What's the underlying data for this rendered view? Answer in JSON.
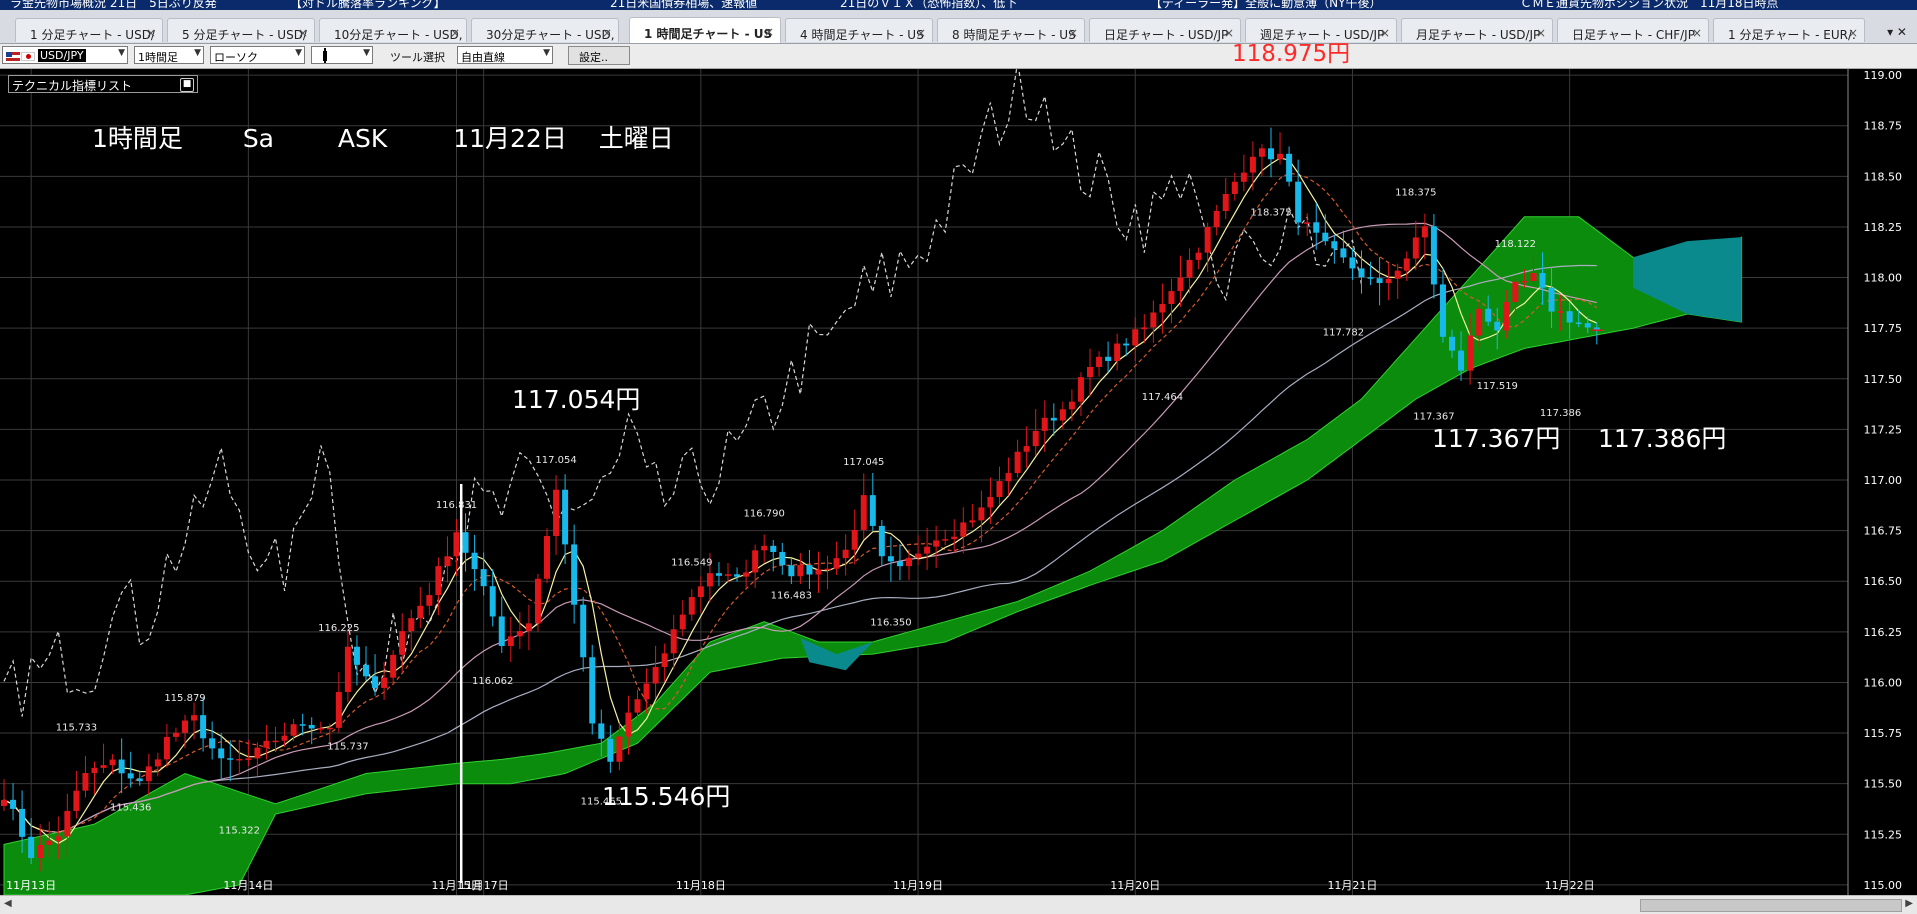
{
  "news_items": [
    "ラ金先物市場概況 21日　5日ぶり反発",
    "【対ドル騰落率ランキング】",
    "21日米国債券相場、速報値",
    "21日のＶＩＸ（恐怖指数）、低下",
    "【ディーラー発】全般に動意薄（NY午後）",
    "ＣＭＥ通貨先物ポジション状況　11月18日時点"
  ],
  "tabs": [
    {
      "label": "1 分足チャート - USD/"
    },
    {
      "label": "5 分足チャート - USD/"
    },
    {
      "label": "10分足チャート - USD,"
    },
    {
      "label": "30分足チャート - USD,"
    },
    {
      "label": "1 時間足チャート - US"
    },
    {
      "label": "4 時間足チャート - US"
    },
    {
      "label": "8 時間足チャート - US"
    },
    {
      "label": "日足チャート - USD/JP"
    },
    {
      "label": "週足チャート - USD/JP"
    },
    {
      "label": "月足チャート - USD/JP"
    },
    {
      "label": "日足チャート - CHF/JP"
    },
    {
      "label": "1 分足チャート - EUR/."
    }
  ],
  "active_tab": 4,
  "tab_close": "×",
  "tab_nav": "▾  ✕",
  "toolbar": {
    "symbol": "USD/JPY",
    "timeframe": "1時間足",
    "chart_type": "ローソク",
    "candle_icon": "candle-icon",
    "tool_label": "ツール選択",
    "tool_value": "自由直線",
    "settings_button": "設定.."
  },
  "tech_list": {
    "label": "テクニカル指標リスト"
  },
  "headline": {
    "timeframe": "1時間足",
    "sa": "Sa",
    "side": "ASK",
    "date": "11月22日",
    "weekday": "土曜日"
  },
  "annotations": {
    "high_red": "118.975円",
    "high_1": "117.054円",
    "low_1": "115.546円",
    "low_2": "117.367円",
    "low_3": "117.386円"
  },
  "colors": {
    "up": "#e0161b",
    "down": "#17b9ea",
    "ma_short": "#f7f3a0",
    "ma_mid": "#c89ab6",
    "ma_long": "#a8aec0",
    "kijun": "#d75a2e",
    "lagging": "#d8d8d8",
    "cloud_green": "#0c8c0c",
    "cloud_teal": "#0a8a8c",
    "grid": "#3a3a3a",
    "axis_text": "#ffffff"
  },
  "chart_data": {
    "type": "candlestick",
    "symbol": "USD/JPY",
    "timeframe": "1時間足",
    "price_side": "ASK",
    "ylim": [
      114.95,
      119.05
    ],
    "y_ticks": [
      115.0,
      115.25,
      115.5,
      115.75,
      116.0,
      116.25,
      116.5,
      116.75,
      117.0,
      117.25,
      117.5,
      117.75,
      118.0,
      118.25,
      118.5,
      118.75,
      119.0
    ],
    "x_date_labels": [
      {
        "label": "11月13日",
        "bar": 3
      },
      {
        "label": "11月14日",
        "bar": 27
      },
      {
        "label": "11月15日",
        "bar": 50
      },
      {
        "label": "11月17日",
        "bar": 53
      },
      {
        "label": "11月18日",
        "bar": 77
      },
      {
        "label": "11月19日",
        "bar": 101
      },
      {
        "label": "11月20日",
        "bar": 125
      },
      {
        "label": "11月21日",
        "bar": 149
      },
      {
        "label": "11月22日",
        "bar": 173
      }
    ],
    "price_labels": [
      {
        "text": "114.898",
        "bar": 2
      },
      {
        "text": "115.733",
        "bar": 8
      },
      {
        "text": "115.879",
        "bar": 20
      },
      {
        "text": "115.436",
        "bar": 14
      },
      {
        "text": "115.322",
        "bar": 26
      },
      {
        "text": "116.225",
        "bar": 37
      },
      {
        "text": "115.737",
        "bar": 38
      },
      {
        "text": "116.831",
        "bar": 50
      },
      {
        "text": "116.062",
        "bar": 54
      },
      {
        "text": "117.054",
        "bar": 61
      },
      {
        "text": "115.465",
        "bar": 66
      },
      {
        "text": "116.549",
        "bar": 76
      },
      {
        "text": "116.790",
        "bar": 84
      },
      {
        "text": "116.483",
        "bar": 87
      },
      {
        "text": "117.045",
        "bar": 95
      },
      {
        "text": "116.350",
        "bar": 98
      },
      {
        "text": "118.375",
        "bar": 140
      },
      {
        "text": "117.464",
        "bar": 128
      },
      {
        "text": "118.375",
        "bar": 156
      },
      {
        "text": "117.782",
        "bar": 148
      },
      {
        "text": "118.122",
        "bar": 167
      },
      {
        "text": "117.367",
        "bar": 158
      },
      {
        "text": "117.519",
        "bar": 165
      },
      {
        "text": "117.386",
        "bar": 172
      }
    ],
    "anchors": [
      [
        0,
        115.45
      ],
      [
        3,
        115.15
      ],
      [
        6,
        115.25
      ],
      [
        9,
        115.55
      ],
      [
        12,
        115.6
      ],
      [
        15,
        115.5
      ],
      [
        18,
        115.72
      ],
      [
        21,
        115.82
      ],
      [
        24,
        115.6
      ],
      [
        27,
        115.62
      ],
      [
        30,
        115.72
      ],
      [
        33,
        115.8
      ],
      [
        36,
        115.78
      ],
      [
        38,
        116.15
      ],
      [
        41,
        115.95
      ],
      [
        44,
        116.25
      ],
      [
        47,
        116.45
      ],
      [
        50,
        116.75
      ],
      [
        53,
        116.45
      ],
      [
        55,
        116.2
      ],
      [
        58,
        116.3
      ],
      [
        61,
        116.95
      ],
      [
        63,
        116.4
      ],
      [
        65,
        115.8
      ],
      [
        67,
        115.6
      ],
      [
        69,
        115.85
      ],
      [
        72,
        116.05
      ],
      [
        75,
        116.35
      ],
      [
        78,
        116.55
      ],
      [
        81,
        116.5
      ],
      [
        84,
        116.7
      ],
      [
        87,
        116.55
      ],
      [
        90,
        116.55
      ],
      [
        93,
        116.65
      ],
      [
        95,
        116.9
      ],
      [
        97,
        116.6
      ],
      [
        99,
        116.55
      ],
      [
        102,
        116.7
      ],
      [
        105,
        116.75
      ],
      [
        108,
        116.85
      ],
      [
        111,
        117.05
      ],
      [
        114,
        117.25
      ],
      [
        117,
        117.35
      ],
      [
        120,
        117.55
      ],
      [
        123,
        117.65
      ],
      [
        126,
        117.75
      ],
      [
        129,
        117.95
      ],
      [
        132,
        118.15
      ],
      [
        135,
        118.4
      ],
      [
        138,
        118.62
      ],
      [
        141,
        118.6
      ],
      [
        143,
        118.3
      ],
      [
        146,
        118.15
      ],
      [
        149,
        118.05
      ],
      [
        152,
        117.95
      ],
      [
        155,
        118.1
      ],
      [
        157,
        118.25
      ],
      [
        159,
        117.7
      ],
      [
        161,
        117.55
      ],
      [
        163,
        117.85
      ],
      [
        165,
        117.75
      ],
      [
        167,
        117.95
      ],
      [
        169,
        118.0
      ],
      [
        171,
        117.85
      ],
      [
        173,
        117.8
      ],
      [
        175,
        117.75
      ],
      [
        176,
        117.72
      ]
    ],
    "cloud_span_a": [
      [
        0,
        115.2
      ],
      [
        10,
        115.3
      ],
      [
        20,
        115.55
      ],
      [
        30,
        115.4
      ],
      [
        40,
        115.55
      ],
      [
        50,
        115.6
      ],
      [
        55,
        115.62
      ],
      [
        60,
        115.65
      ],
      [
        66,
        115.7
      ],
      [
        72,
        115.9
      ],
      [
        78,
        116.2
      ],
      [
        84,
        116.3
      ],
      [
        90,
        116.2
      ],
      [
        96,
        116.2
      ],
      [
        104,
        116.3
      ],
      [
        112,
        116.4
      ],
      [
        120,
        116.55
      ],
      [
        128,
        116.75
      ],
      [
        136,
        117.0
      ],
      [
        144,
        117.2
      ],
      [
        150,
        117.4
      ],
      [
        156,
        117.7
      ],
      [
        162,
        118.0
      ],
      [
        168,
        118.3
      ],
      [
        174,
        118.3
      ],
      [
        180,
        118.1
      ],
      [
        186,
        118.0
      ],
      [
        192,
        118.2
      ]
    ],
    "cloud_span_b": [
      [
        0,
        114.95
      ],
      [
        10,
        114.95
      ],
      [
        20,
        114.95
      ],
      [
        26,
        115.0
      ],
      [
        30,
        115.35
      ],
      [
        40,
        115.45
      ],
      [
        50,
        115.5
      ],
      [
        56,
        115.5
      ],
      [
        62,
        115.55
      ],
      [
        70,
        115.7
      ],
      [
        78,
        116.05
      ],
      [
        86,
        116.12
      ],
      [
        96,
        116.14
      ],
      [
        104,
        116.2
      ],
      [
        112,
        116.35
      ],
      [
        120,
        116.48
      ],
      [
        128,
        116.6
      ],
      [
        136,
        116.8
      ],
      [
        144,
        117.0
      ],
      [
        150,
        117.2
      ],
      [
        156,
        117.4
      ],
      [
        162,
        117.55
      ],
      [
        168,
        117.65
      ],
      [
        174,
        117.7
      ],
      [
        180,
        117.75
      ],
      [
        186,
        117.82
      ],
      [
        192,
        117.78
      ]
    ],
    "series_notes": [
      "ローソク足",
      "移動平均線",
      "一目均衡表",
      "遅行スパン"
    ]
  }
}
